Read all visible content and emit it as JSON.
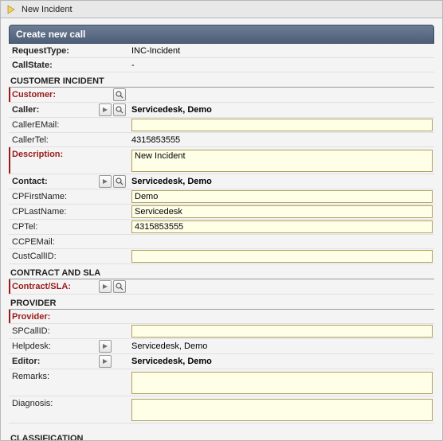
{
  "tab": {
    "title": "New Incident"
  },
  "header": {
    "title": "Create new call"
  },
  "sections": {
    "customer_incident": "CUSTOMER INCIDENT",
    "contract_sla": "CONTRACT AND SLA",
    "provider": "PROVIDER",
    "classification": "CLASSIFICATION"
  },
  "fields": {
    "requestType": {
      "label": "RequestType:",
      "value": "INC-Incident"
    },
    "callState": {
      "label": "CallState:",
      "value": "-"
    },
    "customer": {
      "label": "Customer:",
      "value": ""
    },
    "caller": {
      "label": "Caller:",
      "value": "Servicedesk, Demo"
    },
    "callerEmail": {
      "label": "CallerEMail:",
      "value": ""
    },
    "callerTel": {
      "label": "CallerTel:",
      "value": "4315853555"
    },
    "description": {
      "label": "Description:",
      "value": "New Incident"
    },
    "contact": {
      "label": "Contact:",
      "value": "Servicedesk, Demo"
    },
    "cpFirstName": {
      "label": "CPFirstName:",
      "value": "Demo"
    },
    "cpLastName": {
      "label": "CPLastName:",
      "value": "Servicedesk"
    },
    "cpTel": {
      "label": "CPTel:",
      "value": "4315853555"
    },
    "ccpeMail": {
      "label": "CCPEMail:",
      "value": ""
    },
    "custCallID": {
      "label": "CustCallID:",
      "value": ""
    },
    "contractSla": {
      "label": "Contract/SLA:",
      "value": ""
    },
    "provider": {
      "label": "Provider:",
      "value": ""
    },
    "spCallID": {
      "label": "SPCallID:",
      "value": ""
    },
    "helpdesk": {
      "label": "Helpdesk:",
      "value": "Servicedesk, Demo"
    },
    "editor": {
      "label": "Editor:",
      "value": "Servicedesk, Demo"
    },
    "remarks": {
      "label": "Remarks:",
      "value": ""
    },
    "diagnosis": {
      "label": "Diagnosis:",
      "value": ""
    }
  }
}
